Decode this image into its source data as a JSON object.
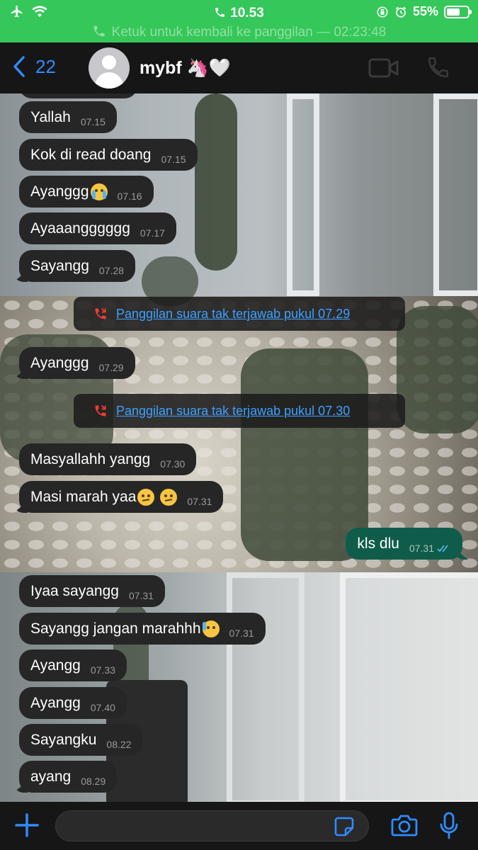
{
  "status_bar": {
    "time": "10.53",
    "battery": "55%",
    "battery_level": 0.55,
    "call_banner": "Ketuk untuk kembali ke panggilan — 02:23:48"
  },
  "header": {
    "back_count": "22",
    "contact_name": "mybf 🦄🤍"
  },
  "messages": [
    {
      "text": "Yallah",
      "time": "07.15"
    },
    {
      "text": "Kok di read doang",
      "time": "07.15"
    },
    {
      "text": "Ayanggg",
      "time": "07.16"
    },
    {
      "text": "Ayaaangggggg",
      "time": "07.17"
    },
    {
      "text": "Sayangg",
      "time": "07.28"
    },
    {
      "text": "Ayanggg",
      "time": "07.29"
    },
    {
      "text": "Masyallahh yangg",
      "time": "07.30"
    },
    {
      "text": "Masi marah yaa",
      "time": "07.31"
    },
    {
      "text": "kls dlu",
      "time": "07.31"
    },
    {
      "text": "Iyaa sayangg",
      "time": "07.31"
    },
    {
      "text": "Sayangg jangan marahhh",
      "time": "07.31"
    },
    {
      "text": "Ayangg",
      "time": "07.33"
    },
    {
      "text": "Ayangg",
      "time": "07.40"
    },
    {
      "text": "Sayangku",
      "time": "08.22"
    },
    {
      "text": "ayang",
      "time": "08.29"
    }
  ],
  "call_notices": [
    {
      "text": "Panggilan suara tak terjawab pukul 07.29"
    },
    {
      "text": "Panggilan suara tak terjawab pukul 07.30"
    }
  ],
  "input": {
    "placeholder": ""
  },
  "colors": {
    "status_green": "#35c759",
    "accent_blue": "#2f8cff",
    "incoming_bubble": "#262626",
    "outgoing_bubble": "#0f5c4a",
    "link_blue": "#3ea0ff",
    "missed_call_red": "#ff3b30"
  },
  "icons": [
    "airplane-icon",
    "wifi-icon",
    "phone-icon",
    "orientation-lock-icon",
    "alarm-icon",
    "battery-icon",
    "chevron-left-icon",
    "video-call-icon",
    "voice-call-icon",
    "missed-call-icon",
    "plus-icon",
    "sticker-icon",
    "camera-icon",
    "mic-icon",
    "read-ticks-icon"
  ]
}
